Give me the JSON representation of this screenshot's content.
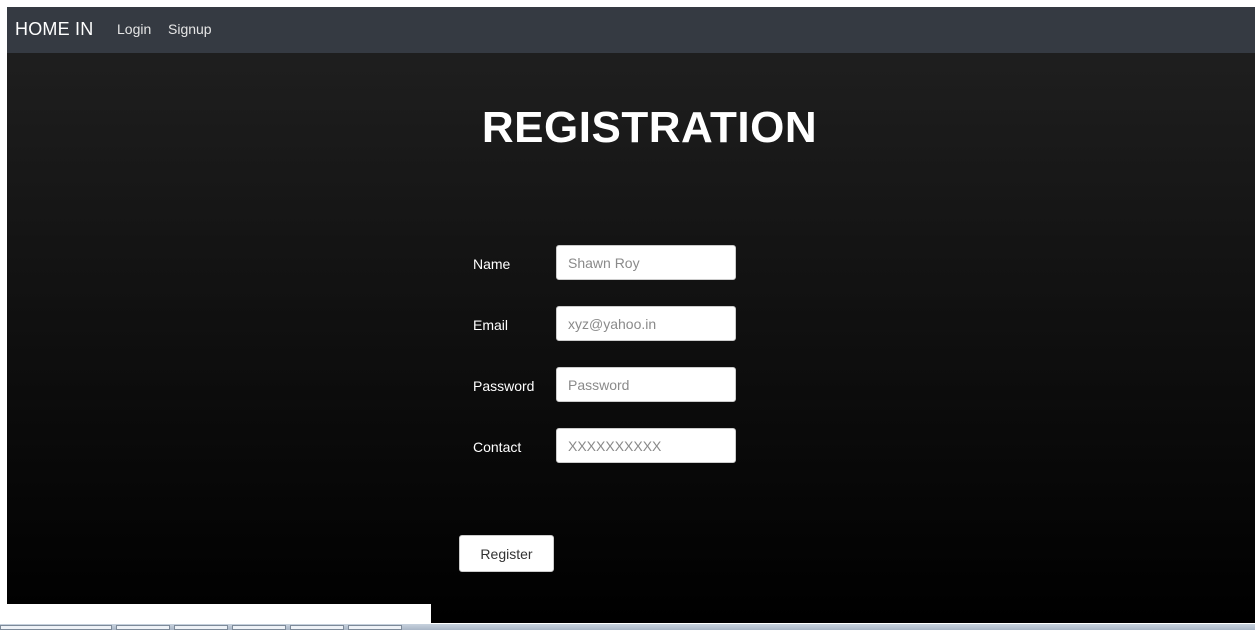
{
  "navbar": {
    "brand": "HOME IN",
    "links": [
      "Login",
      "Signup"
    ]
  },
  "page": {
    "title": "REGISTRATION"
  },
  "form": {
    "fields": [
      {
        "label": "Name",
        "placeholder": "Shawn Roy"
      },
      {
        "label": "Email",
        "placeholder": "xyz@yahoo.in"
      },
      {
        "label": "Password",
        "placeholder": "Password"
      },
      {
        "label": "Contact",
        "placeholder": "XXXXXXXXXX"
      }
    ],
    "submit_label": "Register"
  },
  "colors": {
    "navbar_bg": "#353a42",
    "page_bg_top": "#212121",
    "page_bg_bottom": "#000000"
  }
}
